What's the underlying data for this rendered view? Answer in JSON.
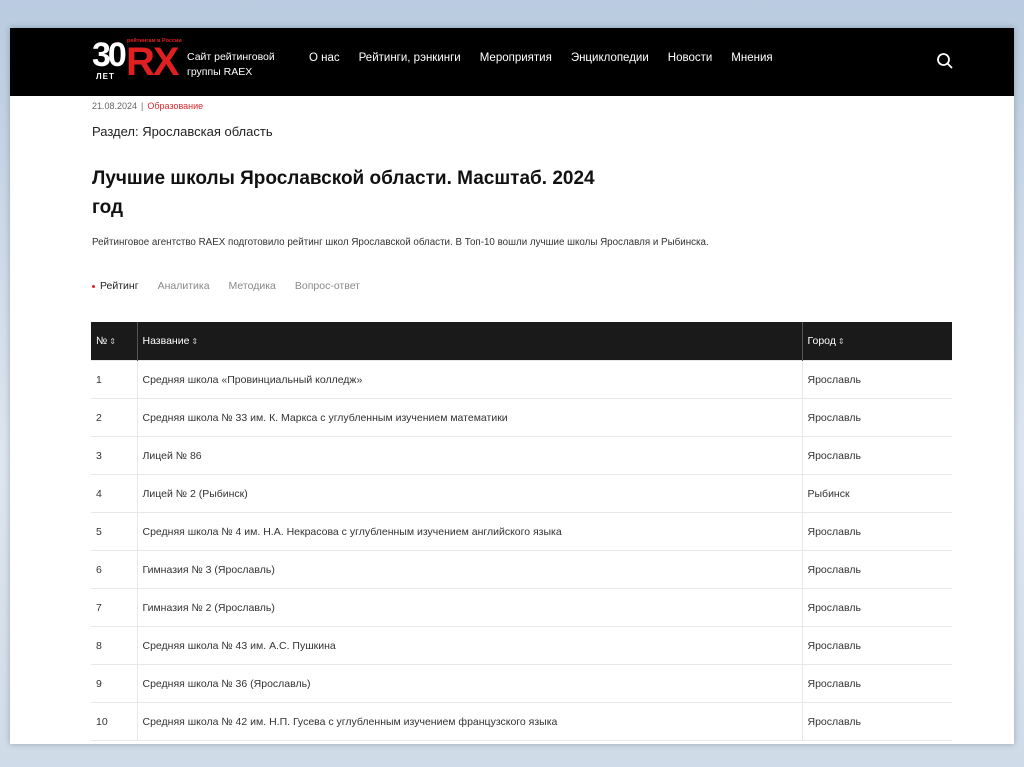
{
  "header": {
    "logo_number": "30",
    "logo_years": "ЛЕТ",
    "logo_brand": "RX",
    "logo_ribbon": "рейтингам в России",
    "site_description": "Сайт рейтинговой группы RAEX",
    "nav": [
      "О нас",
      "Рейтинги, рэнкинги",
      "Мероприятия",
      "Энциклопедии",
      "Новости",
      "Мнения"
    ],
    "search_icon": "search-icon"
  },
  "article": {
    "date": "21.08.2024",
    "separator": "|",
    "category": "Образование",
    "section": "Раздел: Ярославская область",
    "title": "Лучшие школы Ярославской области. Масштаб. 2024 год",
    "lead": "Рейтинговое агентство RAEX подготовило рейтинг школ Ярославской области. В Топ-10 вошли лучшие школы Ярославля и Рыбинска."
  },
  "tabs": [
    {
      "label": "Рейтинг",
      "active": true
    },
    {
      "label": "Аналитика",
      "active": false
    },
    {
      "label": "Методика",
      "active": false
    },
    {
      "label": "Вопрос-ответ",
      "active": false
    }
  ],
  "table": {
    "columns": [
      "№",
      "Название",
      "Город"
    ],
    "sort_glyph": "⇕",
    "rows": [
      {
        "n": "1",
        "name": "Средняя школа «Провинциальный колледж»",
        "city": "Ярославль"
      },
      {
        "n": "2",
        "name": "Средняя школа № 33 им. К. Маркса с углубленным изучением математики",
        "city": "Ярославль"
      },
      {
        "n": "3",
        "name": "Лицей № 86",
        "city": "Ярославль"
      },
      {
        "n": "4",
        "name": "Лицей № 2 (Рыбинск)",
        "city": "Рыбинск"
      },
      {
        "n": "5",
        "name": "Средняя школа № 4 им. Н.А. Некрасова с углубленным изучением  английского языка",
        "city": "Ярославль"
      },
      {
        "n": "6",
        "name": "Гимназия № 3 (Ярославль)",
        "city": "Ярославль"
      },
      {
        "n": "7",
        "name": "Гимназия № 2 (Ярославль)",
        "city": "Ярославль"
      },
      {
        "n": "8",
        "name": "Средняя школа № 43 им. А.С. Пушкина",
        "city": "Ярославль"
      },
      {
        "n": "9",
        "name": "Средняя школа № 36 (Ярославль)",
        "city": "Ярославль"
      },
      {
        "n": "10",
        "name": "Средняя школа № 42 им. Н.П. Гусева с углубленным изучением французского языка",
        "city": "Ярославль"
      }
    ]
  },
  "colors": {
    "header_bg": "#000000",
    "accent": "#d9262b",
    "table_header_bg": "#1a1a1a"
  }
}
